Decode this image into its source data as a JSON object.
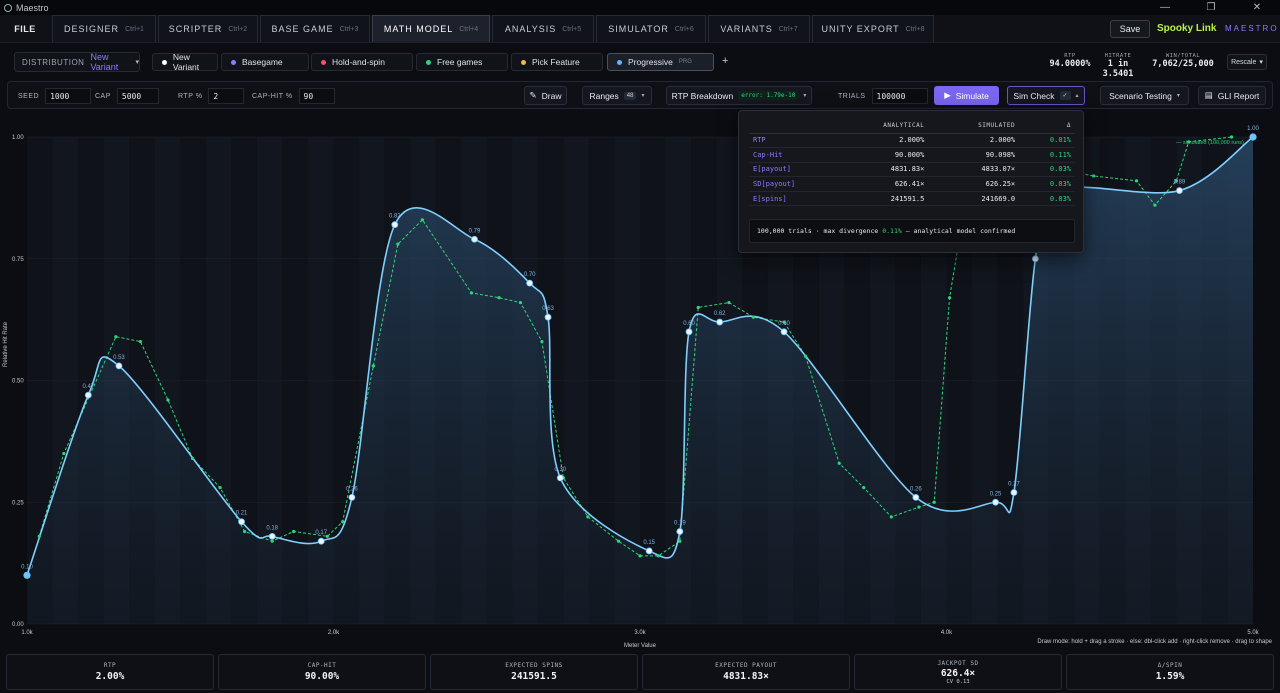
{
  "window": {
    "title": "Maestro"
  },
  "menu": {
    "file": "FILE",
    "tabs": [
      {
        "label": "DESIGNER",
        "shortcut": "Ctrl+1"
      },
      {
        "label": "SCRIPTER",
        "shortcut": "Ctrl+2"
      },
      {
        "label": "BASE GAME",
        "shortcut": "Ctrl+3"
      },
      {
        "label": "MATH MODEL",
        "shortcut": "Ctrl+4"
      },
      {
        "label": "ANALYSIS",
        "shortcut": "Ctrl+5"
      },
      {
        "label": "SIMULATOR",
        "shortcut": "Ctrl+6"
      },
      {
        "label": "VARIANTS",
        "shortcut": "Ctrl+7"
      },
      {
        "label": "UNITY EXPORT",
        "shortcut": "Ctrl+8"
      }
    ],
    "active_tab": "MATH MODEL",
    "save": "Save",
    "project": "Spooky Link",
    "brand": "MAESTRO"
  },
  "distribution": {
    "label": "DISTRIBUTION",
    "value": "New Variant",
    "tabs": [
      {
        "label": "New Variant",
        "color": "#ffffff"
      },
      {
        "label": "Basegame",
        "color": "#8b7bff"
      },
      {
        "label": "Hold-and-spin",
        "color": "#ff4d6a"
      },
      {
        "label": "Free games",
        "color": "#35d07f"
      },
      {
        "label": "Pick Feature",
        "color": "#f5b942"
      },
      {
        "label": "Progressive",
        "color": "#5fb4ff",
        "tag": "PRG"
      }
    ],
    "add": "+",
    "stats": {
      "rtp_label": "RTP",
      "rtp": "94.0000%",
      "hitrate_label": "HITRATE",
      "hitrate": "1 in 3.5401",
      "wintotal_label": "WIN/TOTAL",
      "wintotal": "7,062/25,000"
    },
    "rescale": "Rescale"
  },
  "controls": {
    "seed_label": "SEED",
    "seed": "1000",
    "cap_label": "CAP",
    "cap": "5000",
    "rtp_label": "RTP %",
    "rtp": "2",
    "caphit_label": "CAP-HIT %",
    "caphit": "90",
    "draw": "Draw",
    "ranges": "Ranges",
    "ranges_count": "48",
    "rtp_breakdown": "RTP Breakdown",
    "error": "error: 1.79e-10",
    "trials_label": "TRIALS",
    "trials": "100000",
    "simulate": "Simulate",
    "sim_check": "Sim Check",
    "scenario": "Scenario Testing",
    "gli": "GLI Report"
  },
  "sim_check": {
    "headers": [
      "",
      "ANALYTICAL",
      "SIMULATED",
      "Δ"
    ],
    "rows": [
      {
        "metric": "RTP",
        "analytical": "2.000%",
        "simulated": "2.000%",
        "delta": "0.01%"
      },
      {
        "metric": "Cap-Hit",
        "analytical": "90.000%",
        "simulated": "90.098%",
        "delta": "0.11%"
      },
      {
        "metric": "E[payout]",
        "analytical": "4831.83×",
        "simulated": "4833.07×",
        "delta": "0.03%"
      },
      {
        "metric": "SD[payout]",
        "analytical": "626.41×",
        "simulated": "626.25×",
        "delta": "0.03%"
      },
      {
        "metric": "E[spins]",
        "analytical": "241591.5",
        "simulated": "241669.0",
        "delta": "0.03%"
      }
    ],
    "note_pre": "100,000 trials · max divergence ",
    "note_val": "0.11%",
    "note_post": " — analytical model confirmed"
  },
  "chart_data": {
    "type": "line",
    "xlabel": "Meter Value",
    "ylabel": "Relative Hit Rate",
    "xlim": [
      1000,
      5000
    ],
    "ylim": [
      0,
      1
    ],
    "x_ticks": [
      "1.0k",
      "2.0k",
      "3.0k",
      "4.0k",
      "5.0k"
    ],
    "y_ticks": [
      "0.00",
      "0.25",
      "0.50",
      "0.75",
      "1.00"
    ],
    "legend": "— simulated (100,000 runs)",
    "hint": "Draw mode: hold + drag a stroke · else: dbl-click add · right-click remove · drag to shape",
    "series": [
      {
        "name": "analytical",
        "color": "#6cc4ff",
        "points": [
          [
            1000,
            0.1,
            "0.10"
          ],
          [
            1200,
            0.47,
            "0.47"
          ],
          [
            1300,
            0.53,
            "0.53"
          ],
          [
            1700,
            0.21,
            "0.21"
          ],
          [
            1800,
            0.18,
            "0.18"
          ],
          [
            1960,
            0.17,
            "0.17"
          ],
          [
            2060,
            0.26,
            "0.26"
          ],
          [
            2200,
            0.82,
            "0.82"
          ],
          [
            2460,
            0.79,
            "0.79"
          ],
          [
            2640,
            0.7,
            "0.70"
          ],
          [
            2700,
            0.63,
            "0.63"
          ],
          [
            2740,
            0.3,
            "0.30"
          ],
          [
            3030,
            0.15,
            "0.15"
          ],
          [
            3130,
            0.19,
            "0.19"
          ],
          [
            3160,
            0.6,
            "0.60"
          ],
          [
            3260,
            0.62,
            "0.62"
          ],
          [
            3470,
            0.6,
            "0.60"
          ],
          [
            3900,
            0.26,
            "0.26"
          ],
          [
            4160,
            0.25,
            "0.25"
          ],
          [
            4220,
            0.27,
            "0.27"
          ],
          [
            4290,
            0.75,
            "0.75"
          ],
          [
            4360,
            0.89,
            "0.89"
          ],
          [
            4760,
            0.89,
            "0.89"
          ],
          [
            5000,
            1.0,
            "1.00"
          ]
        ]
      },
      {
        "name": "simulated (100,000 runs)",
        "color": "#2fd57a",
        "points": [
          [
            1040,
            0.18
          ],
          [
            1120,
            0.35
          ],
          [
            1290,
            0.59
          ],
          [
            1370,
            0.58
          ],
          [
            1460,
            0.46
          ],
          [
            1540,
            0.34
          ],
          [
            1630,
            0.28
          ],
          [
            1710,
            0.19
          ],
          [
            1800,
            0.17
          ],
          [
            1870,
            0.19
          ],
          [
            1980,
            0.18
          ],
          [
            2030,
            0.21
          ],
          [
            2130,
            0.53
          ],
          [
            2210,
            0.78
          ],
          [
            2290,
            0.83
          ],
          [
            2450,
            0.68
          ],
          [
            2540,
            0.67
          ],
          [
            2610,
            0.66
          ],
          [
            2680,
            0.58
          ],
          [
            2750,
            0.3
          ],
          [
            2830,
            0.22
          ],
          [
            2930,
            0.17
          ],
          [
            3000,
            0.14
          ],
          [
            3060,
            0.14
          ],
          [
            3130,
            0.17
          ],
          [
            3190,
            0.65
          ],
          [
            3290,
            0.66
          ],
          [
            3370,
            0.63
          ],
          [
            3470,
            0.62
          ],
          [
            3540,
            0.55
          ],
          [
            3650,
            0.33
          ],
          [
            3730,
            0.28
          ],
          [
            3820,
            0.22
          ],
          [
            3910,
            0.24
          ],
          [
            3960,
            0.25
          ],
          [
            4010,
            0.67
          ],
          [
            4060,
            0.86
          ],
          [
            4150,
            0.85
          ],
          [
            4240,
            0.85
          ],
          [
            4310,
            0.94
          ],
          [
            4480,
            0.92
          ],
          [
            4620,
            0.91
          ],
          [
            4680,
            0.86
          ],
          [
            4750,
            0.91
          ],
          [
            4790,
            0.99
          ],
          [
            4930,
            1.0
          ]
        ]
      }
    ]
  },
  "footer": [
    {
      "label": "RTP",
      "value": "2.00%"
    },
    {
      "label": "CAP-HIT",
      "value": "90.00%"
    },
    {
      "label": "EXPECTED SPINS",
      "value": "241591.5"
    },
    {
      "label": "EXPECTED PAYOUT",
      "value": "4831.83×"
    },
    {
      "label": "JACKPOT SD",
      "value": "626.4×",
      "sub": "CV 0.13"
    },
    {
      "label": "Δ/SPIN",
      "value": "1.59%"
    }
  ]
}
